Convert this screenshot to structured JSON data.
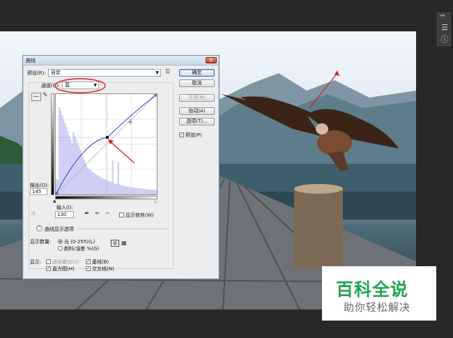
{
  "dialog": {
    "title": "曲线",
    "preset_label": "预设(R):",
    "preset_value": "自定",
    "channel_label": "通道(C):",
    "channel_value": "蓝",
    "ok": "确定",
    "cancel": "取消",
    "smooth": "平滑(M)",
    "auto": "自动(A)",
    "options": "选项(T)...",
    "preview": "预览(P)",
    "output_label": "输出(O):",
    "output_value": "145",
    "input_label": "输入(I):",
    "input_value": "130",
    "show_clipping": "显示修剪(W)",
    "display_options": "曲线显示选项",
    "show_amount_label": "显示数量:",
    "light_option": "光 (0-255)(L)",
    "pigment_option": "颜料/油墨 %(G)",
    "show_label": "显示:",
    "channel_overlays": "通道叠加(V)",
    "baseline": "基线(B)",
    "histogram": "直方图(H)",
    "intersection": "交叉线(N)",
    "curve_point_input": 130,
    "curve_point_output": 145
  },
  "watermark": {
    "big": "百科全说",
    "small": "助你轻松解决"
  },
  "colors": {
    "annotation_red": "#d42020",
    "watermark_green": "#20a74f",
    "curve_blue": "#2a2ad8"
  }
}
